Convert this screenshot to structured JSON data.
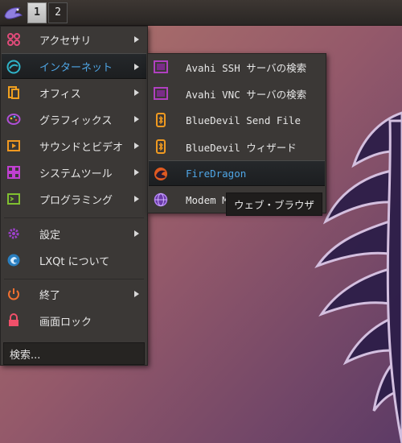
{
  "taskbar": {
    "start_icon": "lxqt-bird-icon",
    "workspaces": [
      {
        "label": "1",
        "active": true
      },
      {
        "label": "2",
        "active": false
      }
    ]
  },
  "main_menu": {
    "items": [
      {
        "label": "アクセサリ",
        "icon": "accessories-icon",
        "has_submenu": true
      },
      {
        "label": "インターネット",
        "icon": "internet-icon",
        "has_submenu": true,
        "highlighted": true
      },
      {
        "label": "オフィス",
        "icon": "office-icon",
        "has_submenu": true
      },
      {
        "label": "グラフィックス",
        "icon": "graphics-icon",
        "has_submenu": true
      },
      {
        "label": "サウンドとビデオ",
        "icon": "sound-video-icon",
        "has_submenu": true
      },
      {
        "label": "システムツール",
        "icon": "system-tools-icon",
        "has_submenu": true
      },
      {
        "label": "プログラミング",
        "icon": "programming-icon",
        "has_submenu": true
      },
      {
        "label": "設定",
        "icon": "settings-icon",
        "has_submenu": true
      },
      {
        "label": "LXQt について",
        "icon": "about-lxqt-icon",
        "has_submenu": false
      },
      {
        "label": "終了",
        "icon": "power-icon",
        "has_submenu": true
      },
      {
        "label": "画面ロック",
        "icon": "lock-icon",
        "has_submenu": false
      }
    ],
    "search_placeholder": "検索..."
  },
  "internet_submenu": {
    "items": [
      {
        "label": "Avahi SSH サーバの検索",
        "icon": "avahi-ssh-icon"
      },
      {
        "label": "Avahi VNC サーバの検索",
        "icon": "avahi-vnc-icon"
      },
      {
        "label": "BlueDevil Send File",
        "icon": "bluetooth-icon"
      },
      {
        "label": "BlueDevil ウィザード",
        "icon": "bluetooth-icon"
      },
      {
        "label": "FireDragon",
        "icon": "firedragon-icon",
        "highlighted": true
      },
      {
        "label": "Modem Ma",
        "icon": "globe-icon"
      }
    ]
  },
  "tooltip": {
    "text": "ウェブ・ブラウザ"
  },
  "colors": {
    "highlight_text": "#4fa6e6",
    "menu_bg": "#3b3836",
    "wallpaper_top": "#a86e60",
    "wallpaper_bottom": "#5e3f66"
  }
}
